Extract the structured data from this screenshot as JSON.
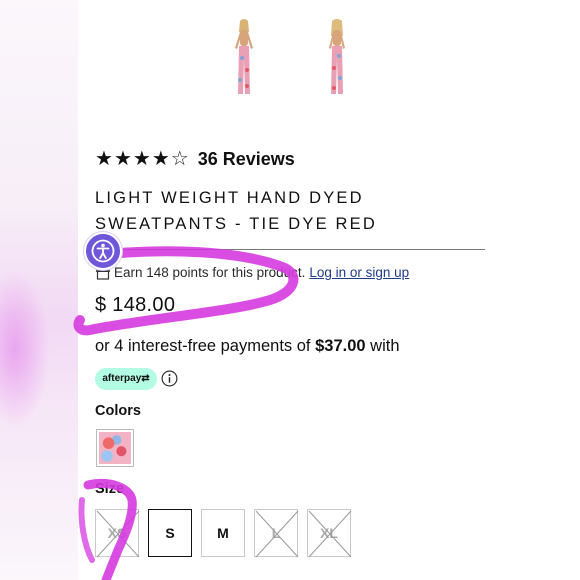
{
  "product": {
    "rating_stars": [
      "★",
      "★",
      "★",
      "★",
      "☆"
    ],
    "reviews": "36 Reviews",
    "title_line1": "LIGHT WEIGHT HAND DYED",
    "title_line2": "SWEATPANTS - TIE DYE RED",
    "points_text": "Earn 148 points for this product.",
    "points_link": "Log in or sign up",
    "price": "$ 148.00",
    "installments_prefix": "or 4 interest-free payments of ",
    "installments_amount": "$37.00",
    "installments_suffix": " with",
    "afterpay_label": "afterpay",
    "colors_label": "Colors",
    "size_label": "Size",
    "sizes": [
      {
        "label": "XS",
        "available": false,
        "selected": false
      },
      {
        "label": "S",
        "available": true,
        "selected": true
      },
      {
        "label": "M",
        "available": true,
        "selected": false
      },
      {
        "label": "L",
        "available": false,
        "selected": false
      },
      {
        "label": "XL",
        "available": false,
        "selected": false
      }
    ]
  },
  "colors": {
    "accent_marker": "#d63ae0",
    "afterpay_bg": "#b2fce4",
    "accessibility_button": "#6e57d9",
    "link": "#1e3a8a"
  },
  "icons": [
    "accessibility-icon",
    "gift-icon",
    "info-icon",
    "afterpay-arrows-icon",
    "star-icon"
  ]
}
